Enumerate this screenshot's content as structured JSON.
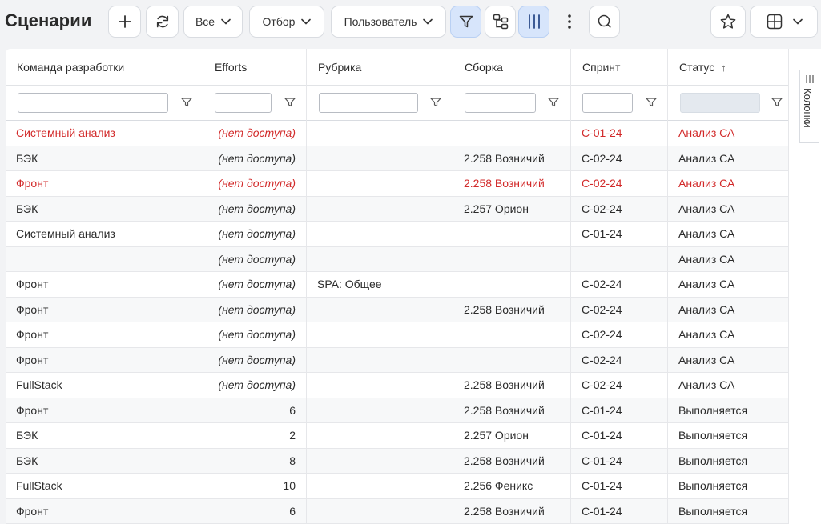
{
  "page": {
    "title": "Сценарии"
  },
  "toolbar": {
    "filter_all": "Все",
    "filter_selection": "Отбор",
    "filter_user": "Пользователь"
  },
  "icons": {
    "add": "plus-icon",
    "refresh": "refresh-icon",
    "filter": "filter-icon",
    "hierarchy": "hierarchy-icon",
    "columns": "columns-icon",
    "more": "more-vertical-icon",
    "search": "search-icon",
    "favorite": "star-icon",
    "layout": "table-layout-icon"
  },
  "colors": {
    "accent_bg": "#d7e5fb",
    "error_red": "#d22a2a"
  },
  "side_panel": {
    "columns_label": "Колонки"
  },
  "table": {
    "columns": [
      {
        "label": "Команда разработки"
      },
      {
        "label": "Efforts"
      },
      {
        "label": "Рубрика"
      },
      {
        "label": "Сборка"
      },
      {
        "label": "Спринт"
      },
      {
        "label": "Статус",
        "sort": "↑"
      }
    ],
    "rows": [
      {
        "team": "Системный анализ",
        "efforts": "(нет доступа)",
        "rubric": "",
        "build": "",
        "sprint": "С-01-24",
        "status": "Анализ СА",
        "highlight": true
      },
      {
        "team": "БЭК",
        "efforts": "(нет доступа)",
        "rubric": "",
        "build": "2.258 Возничий",
        "sprint": "С-02-24",
        "status": "Анализ СА",
        "highlight": false
      },
      {
        "team": "Фронт",
        "efforts": "(нет доступа)",
        "rubric": "",
        "build": "2.258 Возничий",
        "sprint": "С-02-24",
        "status": "Анализ СА",
        "highlight": true
      },
      {
        "team": "БЭК",
        "efforts": "(нет доступа)",
        "rubric": "",
        "build": "2.257 Орион",
        "sprint": "С-02-24",
        "status": "Анализ СА",
        "highlight": false
      },
      {
        "team": "Системный анализ",
        "efforts": "(нет доступа)",
        "rubric": "",
        "build": "",
        "sprint": "С-01-24",
        "status": "Анализ СА",
        "highlight": false
      },
      {
        "team": "",
        "efforts": "(нет доступа)",
        "rubric": "",
        "build": "",
        "sprint": "",
        "status": "Анализ СА",
        "highlight": false
      },
      {
        "team": "Фронт",
        "efforts": "(нет доступа)",
        "rubric": "SPA: Общее",
        "build": "",
        "sprint": "С-02-24",
        "status": "Анализ СА",
        "highlight": false
      },
      {
        "team": "Фронт",
        "efforts": "(нет доступа)",
        "rubric": "",
        "build": "2.258 Возничий",
        "sprint": "С-02-24",
        "status": "Анализ СА",
        "highlight": false
      },
      {
        "team": "Фронт",
        "efforts": "(нет доступа)",
        "rubric": "",
        "build": "",
        "sprint": "С-02-24",
        "status": "Анализ СА",
        "highlight": false
      },
      {
        "team": "Фронт",
        "efforts": "(нет доступа)",
        "rubric": "",
        "build": "",
        "sprint": "С-02-24",
        "status": "Анализ СА",
        "highlight": false
      },
      {
        "team": "FullStack",
        "efforts": "(нет доступа)",
        "rubric": "",
        "build": "2.258 Возничий",
        "sprint": "С-02-24",
        "status": "Анализ СА",
        "highlight": false
      },
      {
        "team": "Фронт",
        "efforts": "6",
        "rubric": "",
        "build": "2.258 Возничий",
        "sprint": "С-01-24",
        "status": "Выполняется",
        "highlight": false
      },
      {
        "team": "БЭК",
        "efforts": "2",
        "rubric": "",
        "build": "2.257 Орион",
        "sprint": "С-01-24",
        "status": "Выполняется",
        "highlight": false
      },
      {
        "team": "БЭК",
        "efforts": "8",
        "rubric": "",
        "build": "2.258 Возничий",
        "sprint": "С-01-24",
        "status": "Выполняется",
        "highlight": false
      },
      {
        "team": "FullStack",
        "efforts": "10",
        "rubric": "",
        "build": "2.256 Феникс",
        "sprint": "С-01-24",
        "status": "Выполняется",
        "highlight": false
      },
      {
        "team": "Фронт",
        "efforts": "6",
        "rubric": "",
        "build": "2.258 Возничий",
        "sprint": "С-01-24",
        "status": "Выполняется",
        "highlight": false
      }
    ]
  }
}
